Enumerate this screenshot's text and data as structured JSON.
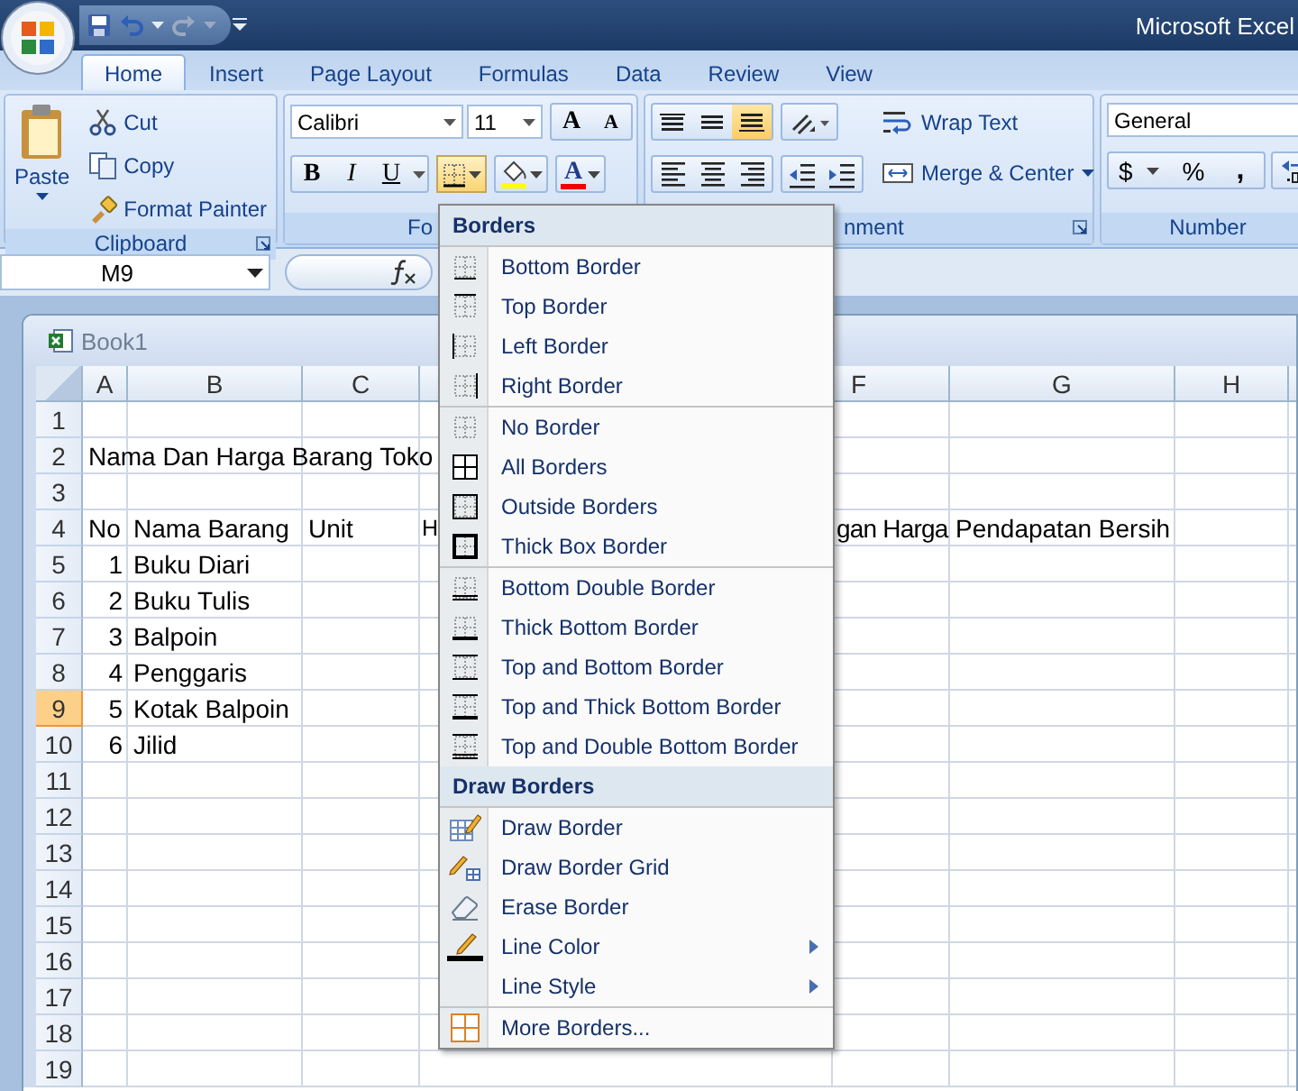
{
  "title_bar": {
    "title": "Microsoft Excel"
  },
  "tabs": [
    {
      "label": "Home",
      "selected": true
    },
    {
      "label": "Insert",
      "selected": false
    },
    {
      "label": "Page Layout",
      "selected": false
    },
    {
      "label": "Formulas",
      "selected": false
    },
    {
      "label": "Data",
      "selected": false
    },
    {
      "label": "Review",
      "selected": false
    },
    {
      "label": "View",
      "selected": false
    }
  ],
  "ribbon": {
    "clipboard": {
      "label": "Clipboard",
      "paste": "Paste",
      "cut": "Cut",
      "copy": "Copy",
      "format_painter": "Format Painter"
    },
    "font": {
      "label": "Fo",
      "font_name": "Calibri",
      "font_size": "11",
      "grow": "A",
      "shrink": "A",
      "bold": "B",
      "italic": "I",
      "underline": "U",
      "font_color": "A",
      "borders_open": true
    },
    "alignment": {
      "label": "nment",
      "vertical": [
        {
          "selected": false
        },
        {
          "selected": false
        },
        {
          "selected": true
        }
      ],
      "wrap_text": "Wrap Text",
      "merge": "Merge & Center"
    },
    "number": {
      "label": "Number",
      "format": "General",
      "currency": "$",
      "percent": "%",
      "comma": ","
    }
  },
  "formula_bar": {
    "name_box": "M9"
  },
  "workbook": {
    "title": "Book1",
    "columns": [
      {
        "label": "A"
      },
      {
        "label": "B"
      },
      {
        "label": "C"
      },
      {
        "label": "F"
      },
      {
        "label": "G"
      },
      {
        "label": "H"
      }
    ],
    "rows": [
      {
        "header": "1",
        "selected": false,
        "cells": {}
      },
      {
        "header": "2",
        "selected": false,
        "cells": {
          "A": {
            "text": "Nama Dan Harga Barang Toko",
            "numeric": false
          }
        }
      },
      {
        "header": "3",
        "selected": false,
        "cells": {}
      },
      {
        "header": "4",
        "selected": false,
        "cells": {
          "A": {
            "text": "No",
            "numeric": false
          },
          "B": {
            "text": "Nama Barang",
            "numeric": false
          },
          "C": {
            "text": "Unit",
            "numeric": false
          },
          "D": {
            "text": "H",
            "numeric": false
          },
          "F": {
            "text": "gan Harga",
            "numeric": false
          },
          "G": {
            "text": "Pendapatan Bersih",
            "numeric": false
          }
        }
      },
      {
        "header": "5",
        "selected": false,
        "cells": {
          "A": {
            "text": "1",
            "numeric": true
          },
          "B": {
            "text": "Buku Diari",
            "numeric": false
          }
        }
      },
      {
        "header": "6",
        "selected": false,
        "cells": {
          "A": {
            "text": "2",
            "numeric": true
          },
          "B": {
            "text": "Buku Tulis",
            "numeric": false
          }
        }
      },
      {
        "header": "7",
        "selected": false,
        "cells": {
          "A": {
            "text": "3",
            "numeric": true
          },
          "B": {
            "text": "Balpoin",
            "numeric": false
          }
        }
      },
      {
        "header": "8",
        "selected": false,
        "cells": {
          "A": {
            "text": "4",
            "numeric": true
          },
          "B": {
            "text": "Penggaris",
            "numeric": false
          }
        }
      },
      {
        "header": "9",
        "selected": true,
        "cells": {
          "A": {
            "text": "5",
            "numeric": true
          },
          "B": {
            "text": "Kotak Balpoin",
            "numeric": false
          }
        }
      },
      {
        "header": "10",
        "selected": false,
        "cells": {
          "A": {
            "text": "6",
            "numeric": true
          },
          "B": {
            "text": "Jilid",
            "numeric": false
          }
        }
      },
      {
        "header": "11",
        "selected": false,
        "cells": {}
      },
      {
        "header": "12",
        "selected": false,
        "cells": {}
      },
      {
        "header": "13",
        "selected": false,
        "cells": {}
      },
      {
        "header": "14",
        "selected": false,
        "cells": {}
      },
      {
        "header": "15",
        "selected": false,
        "cells": {}
      },
      {
        "header": "16",
        "selected": false,
        "cells": {}
      },
      {
        "header": "17",
        "selected": false,
        "cells": {}
      },
      {
        "header": "18",
        "selected": false,
        "cells": {}
      },
      {
        "header": "19",
        "selected": false,
        "cells": {}
      }
    ]
  },
  "borders_menu": {
    "sections": [
      {
        "title": "Borders",
        "groups": [
          [
            {
              "label": "Bottom Border",
              "submenu": false
            },
            {
              "label": "Top Border",
              "submenu": false
            },
            {
              "label": "Left Border",
              "submenu": false
            },
            {
              "label": "Right Border",
              "submenu": false
            }
          ],
          [
            {
              "label": "No Border",
              "submenu": false
            },
            {
              "label": "All Borders",
              "submenu": false
            },
            {
              "label": "Outside Borders",
              "submenu": false
            },
            {
              "label": "Thick Box Border",
              "submenu": false
            }
          ],
          [
            {
              "label": "Bottom Double Border",
              "submenu": false
            },
            {
              "label": "Thick Bottom Border",
              "submenu": false
            },
            {
              "label": "Top and Bottom Border",
              "submenu": false
            },
            {
              "label": "Top and Thick Bottom Border",
              "submenu": false
            },
            {
              "label": "Top and Double Bottom Border",
              "submenu": false
            }
          ]
        ]
      },
      {
        "title": "Draw Borders",
        "groups": [
          [
            {
              "label": "Draw Border",
              "submenu": false
            },
            {
              "label": "Draw Border Grid",
              "submenu": false
            },
            {
              "label": "Erase Border",
              "submenu": false
            },
            {
              "label": "Line Color",
              "submenu": true
            },
            {
              "label": "Line Style",
              "submenu": true
            }
          ],
          [
            {
              "label": "More Borders...",
              "submenu": false
            }
          ]
        ]
      }
    ]
  }
}
